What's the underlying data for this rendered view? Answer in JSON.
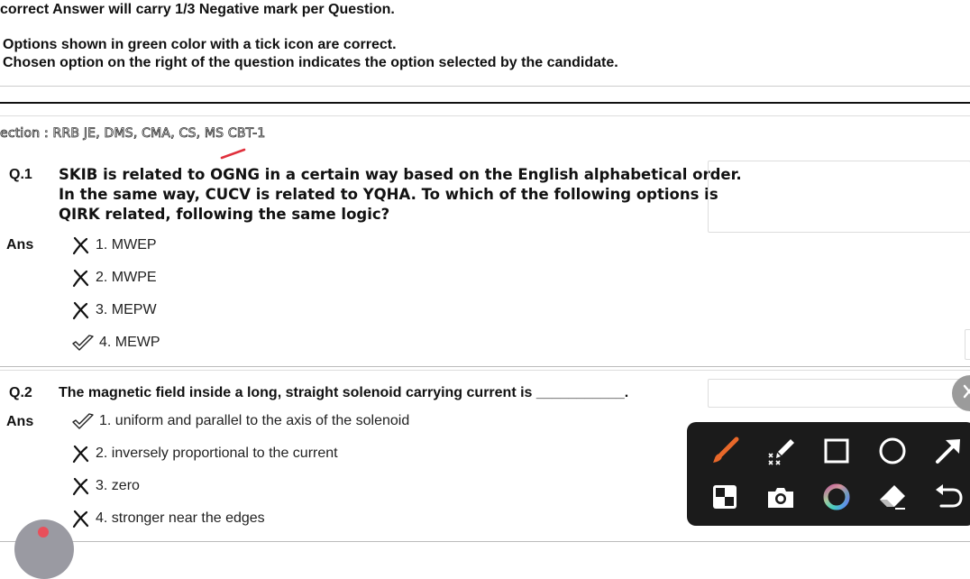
{
  "instructions": {
    "line1": "correct Answer will carry 1/3 Negative mark per Question.",
    "line2": "Options shown in green color with a tick icon are correct.",
    "line3": "Chosen option on the right of the question indicates the option selected by the candidate."
  },
  "section": {
    "label": "ection : RRB JE, DMS, CMA, CS, MS CBT-1"
  },
  "questions": [
    {
      "number": "Q.1",
      "text_lines": [
        "SKIB is related to OGNG in a certain way based on the English alphabetical order.",
        "In the same way, CUCV is related to YQHA. To which of the following options is",
        "QIRK related, following the same logic?"
      ],
      "ans_label": "Ans",
      "options": [
        {
          "label": "1. MWEP",
          "mark": "cross-icon"
        },
        {
          "label": "2. MWPE",
          "mark": "cross-icon"
        },
        {
          "label": "3. MEPW",
          "mark": "cross-icon"
        },
        {
          "label": "4. MEWP",
          "mark": "tick-icon"
        }
      ]
    },
    {
      "number": "Q.2",
      "text": "The magnetic field inside a long, straight solenoid carrying current is ___________.",
      "ans_label": "Ans",
      "options": [
        {
          "label": "1. uniform and parallel to the axis of the solenoid",
          "mark": "tick-icon"
        },
        {
          "label": "2. inversely proportional to the current",
          "mark": "cross-icon"
        },
        {
          "label": "3. zero",
          "mark": "cross-icon"
        },
        {
          "label": "4. stronger near the edges",
          "mark": "cross-icon"
        }
      ]
    }
  ],
  "toolbar": {
    "tools": [
      "brush-icon",
      "highlighter-icon",
      "rectangle-icon",
      "circle-icon",
      "arrow-icon",
      "mosaic-icon",
      "camera-icon",
      "color-wheel-icon",
      "eraser-icon",
      "undo-icon"
    ]
  },
  "colors": {
    "brush": "#e8682a",
    "annotation": "#e0303c",
    "toolbar_bg": "#1b1b1b"
  }
}
